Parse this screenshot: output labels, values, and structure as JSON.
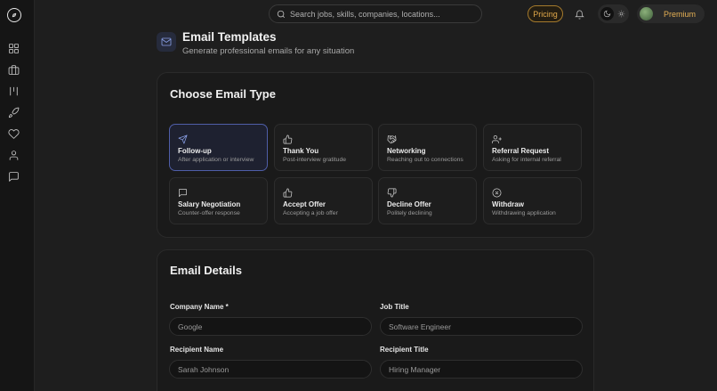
{
  "topbar": {
    "search_placeholder": "Search jobs, skills, companies, locations...",
    "pricing_label": "Pricing",
    "premium_label": "Premium"
  },
  "sidebar": {
    "items": [
      "dashboard-icon",
      "briefcase-icon",
      "board-icon",
      "rocket-icon",
      "heart-icon",
      "user-icon",
      "message-icon"
    ]
  },
  "header": {
    "title": "Email Templates",
    "subtitle": "Generate professional emails for any situation"
  },
  "email_type": {
    "title": "Choose Email Type",
    "options": [
      {
        "title": "Follow-up",
        "desc": "After application or interview",
        "icon": "send-icon",
        "selected": true
      },
      {
        "title": "Thank You",
        "desc": "Post-interview gratitude",
        "icon": "thumbs-up-icon",
        "selected": false
      },
      {
        "title": "Networking",
        "desc": "Reaching out to connections",
        "icon": "handshake-icon",
        "selected": false
      },
      {
        "title": "Referral Request",
        "desc": "Asking for internal referral",
        "icon": "user-plus-icon",
        "selected": false
      },
      {
        "title": "Salary Negotiation",
        "desc": "Counter-offer response",
        "icon": "message-square-icon",
        "selected": false
      },
      {
        "title": "Accept Offer",
        "desc": "Accepting a job offer",
        "icon": "thumbs-up-icon",
        "selected": false
      },
      {
        "title": "Decline Offer",
        "desc": "Politely declining",
        "icon": "thumbs-down-icon",
        "selected": false
      },
      {
        "title": "Withdraw",
        "desc": "Withdrawing application",
        "icon": "x-circle-icon",
        "selected": false
      }
    ]
  },
  "email_details": {
    "title": "Email Details",
    "company_label": "Company Name *",
    "company_placeholder": "Google",
    "job_title_label": "Job Title",
    "job_title_placeholder": "Software Engineer",
    "recipient_name_label": "Recipient Name",
    "recipient_name_placeholder": "Sarah Johnson",
    "recipient_title_label": "Recipient Title",
    "recipient_title_placeholder": "Hiring Manager"
  },
  "colors": {
    "accent": "#8aa0e8",
    "pricing": "#e0a84a",
    "background": "#1e1e1e"
  }
}
